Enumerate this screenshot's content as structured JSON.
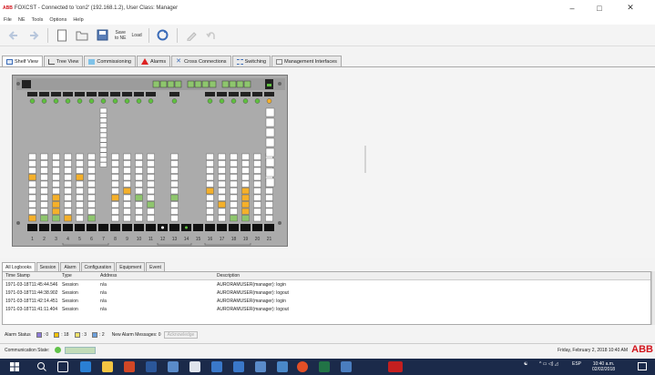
{
  "window": {
    "logo": "ABB",
    "title": "FOXCST - Connected to 'con2' (192.168.1.2), User Class: Manager",
    "controls": [
      "–",
      "□",
      "✕"
    ]
  },
  "menu": [
    "File",
    "NE",
    "Tools",
    "Options",
    "Help"
  ],
  "toolbar": {
    "save_to_ne": "Save\nto NE",
    "load": "Load"
  },
  "tabs": [
    {
      "label": "Shelf View",
      "icon": "shelf-icon"
    },
    {
      "label": "Tree View",
      "icon": "tree-icon"
    },
    {
      "label": "Commissioning",
      "icon": "commissioning-icon"
    },
    {
      "label": "Alarms",
      "icon": "alarm-icon"
    },
    {
      "label": "Cross Connections",
      "icon": "cross-connection-icon"
    },
    {
      "label": "Switching",
      "icon": "switching-icon"
    },
    {
      "label": "Management Interfaces",
      "icon": "management-icon"
    }
  ],
  "shelf": {
    "slot_numbers": [
      "1",
      "2",
      "3",
      "4",
      "5",
      "6",
      "7",
      "8",
      "9",
      "10",
      "11",
      "12",
      "13",
      "14",
      "15",
      "16",
      "17",
      "18",
      "19",
      "20",
      "21"
    ],
    "colors": {
      "orange": "#f5b02a",
      "green": "#8ec66d",
      "white": "#ffffff",
      "frame": "#ababab",
      "led_green": "#5fbf3f"
    }
  },
  "log": {
    "tabs": [
      "All Logbooks",
      "Session",
      "Alarm",
      "Configuration",
      "Equipment",
      "Event"
    ],
    "headers": [
      "Time Stamp",
      "Type",
      "Address",
      "Description"
    ],
    "rows": [
      [
        "1971-03-18T11:45:44.546",
        "Session",
        "n/a",
        "AURORAMUSER(manager): login"
      ],
      [
        "1971-03-18T11:44:38.902",
        "Session",
        "n/a",
        "AURORAMUSER(manager): logout"
      ],
      [
        "1971-03-18T11:42:14.451",
        "Session",
        "n/a",
        "AURORAMUSER(manager): login"
      ],
      [
        "1971-03-18T11:41:11.404",
        "Session",
        "n/a",
        "AURORAMUSER(manager): logout"
      ]
    ]
  },
  "alarm_status": {
    "label": "Alarm Status",
    "counts": [
      {
        "value": ": 0",
        "color": "#8e7ad9"
      },
      {
        "value": ": 18",
        "color": "#f5c200"
      },
      {
        "value": ": 3",
        "color": "#f2e36a"
      },
      {
        "value": ": 2",
        "color": "#6ca0dc"
      }
    ],
    "new_messages": "New Alarm Messages: 0",
    "ack_button": "Acknowledge"
  },
  "comm": {
    "label": "Communication State:",
    "datetime": "Friday, February 2, 2018 10:40 AM",
    "brand": "ABB"
  },
  "taskbar": {
    "lang": "ESP",
    "time": "10:40 a.m.",
    "date": "02/02/2018"
  }
}
